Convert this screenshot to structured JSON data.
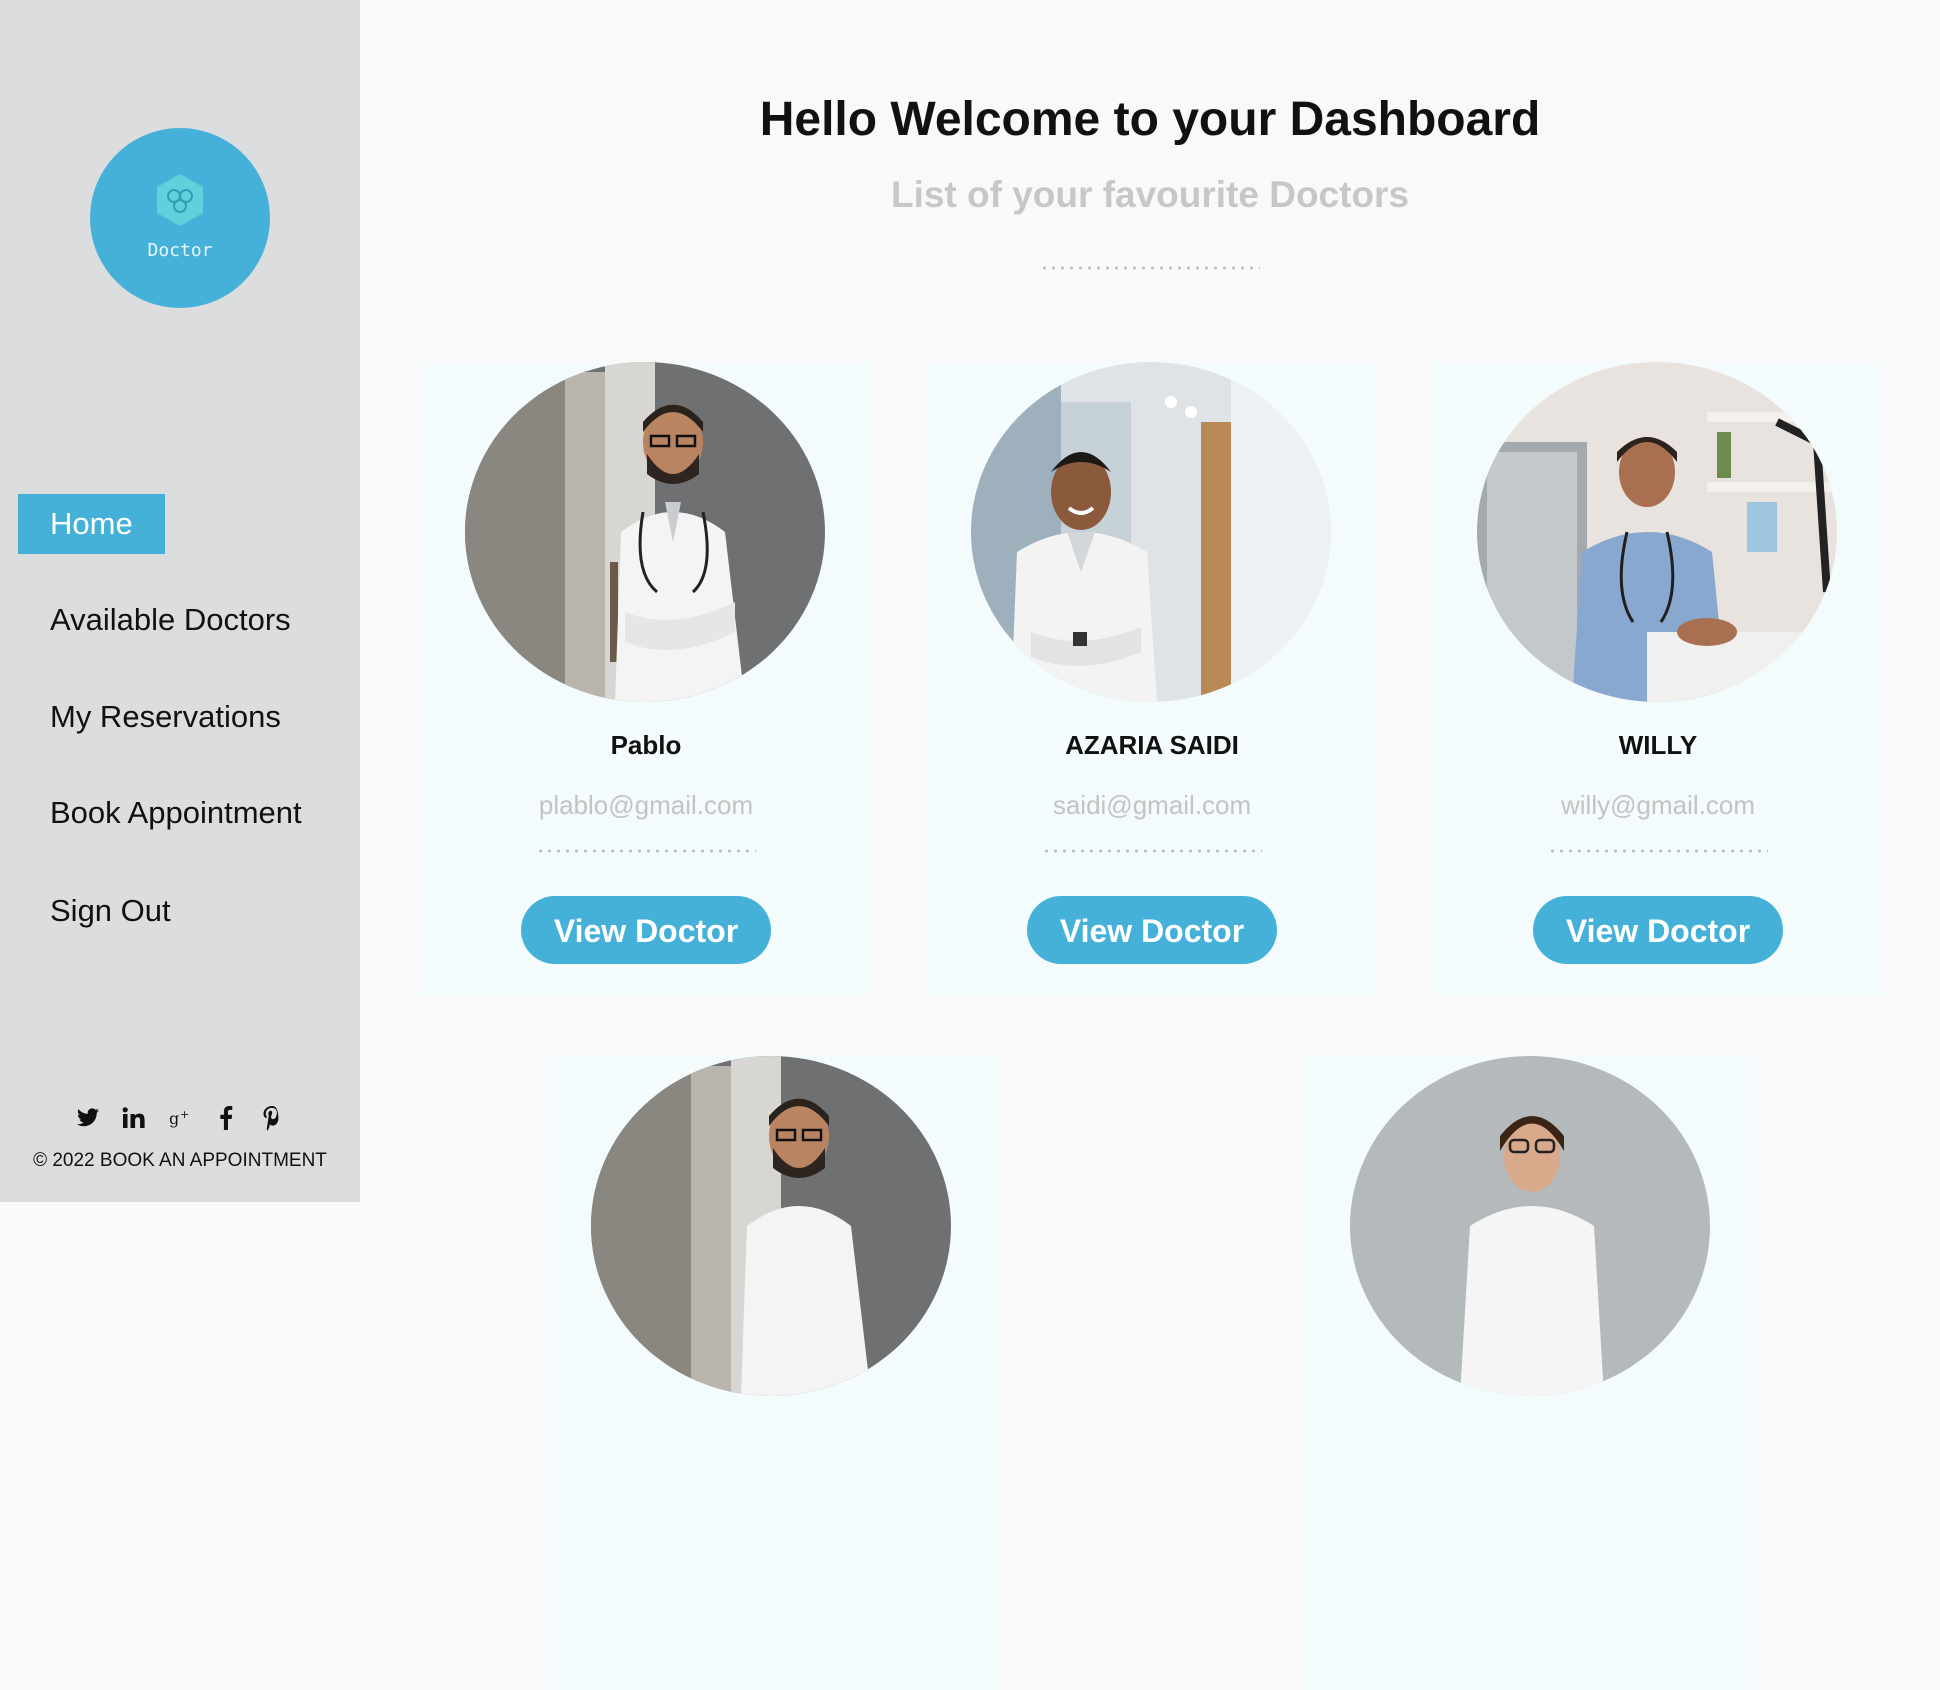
{
  "sidebar": {
    "logo_text": "Doctor",
    "nav": [
      {
        "label": "Home",
        "active": true
      },
      {
        "label": "Available Doctors",
        "active": false
      },
      {
        "label": "My Reservations",
        "active": false
      },
      {
        "label": "Book Appointment",
        "active": false
      },
      {
        "label": "Sign Out",
        "active": false
      }
    ],
    "social_icons": [
      "twitter-icon",
      "linkedin-icon",
      "google-plus-icon",
      "facebook-icon",
      "pinterest-icon"
    ],
    "copyright": "© 2022 BOOK AN APPOINTMENT"
  },
  "main": {
    "title": "Hello Welcome to your Dashboard",
    "subtitle": "List of your favourite Doctors",
    "doctors": [
      {
        "name": "Pablo",
        "email": "plablo@gmail.com",
        "button": "View Doctor"
      },
      {
        "name": "AZARIA SAIDI",
        "email": "saidi@gmail.com",
        "button": "View Doctor"
      },
      {
        "name": "WILLY",
        "email": "willy@gmail.com",
        "button": "View Doctor"
      },
      {
        "name": "",
        "email": "",
        "button": ""
      },
      {
        "name": "",
        "email": "",
        "button": ""
      }
    ]
  },
  "colors": {
    "accent": "#45b1d8",
    "sidebar_bg": "#dcdddf",
    "muted_text": "#c7c7c7"
  }
}
